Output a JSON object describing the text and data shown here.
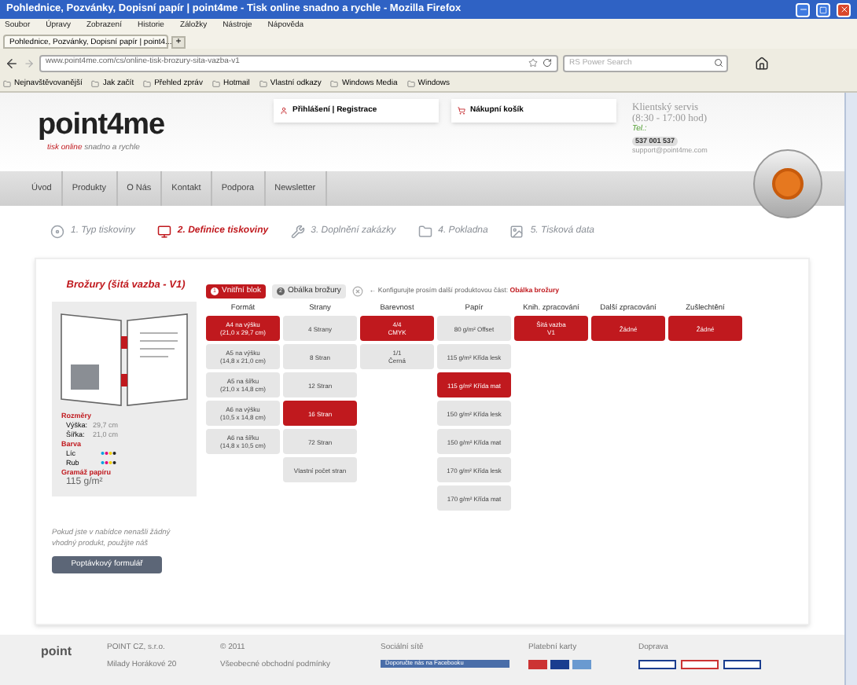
{
  "browser": {
    "title": "Pohlednice, Pozvánky, Dopisní papír | point4me - Tisk online snadno a rychle - Mozilla Firefox",
    "menu": [
      "Soubor",
      "Úpravy",
      "Zobrazení",
      "Historie",
      "Záložky",
      "Nástroje",
      "Nápověda"
    ],
    "tab": "Pohlednice, Pozvánky, Dopisní papír | point4...",
    "new_tab": "+",
    "url": "www.point4me.com/cs/online-tisk-brozury-sita-vazba-v1",
    "search_placeholder": "RS Power Search",
    "bookmarks": [
      "Nejnavštěvovanější",
      "Jak začít",
      "Přehled zpráv",
      "Hotmail",
      "Vlastní odkazy",
      "Windows Media",
      "Windows"
    ]
  },
  "header": {
    "logo": "point4me",
    "tagline_accent": "tisk online",
    "tagline": "snadno a rychle",
    "login": "Přihlášení | Registrace",
    "cart": "Nákupní košík",
    "service": "Klientský servis",
    "hours": "(8:30 - 17:00 hod)",
    "tel_label": "Tel.:",
    "phone": "537 001 537",
    "email": "support@point4me.com"
  },
  "nav": [
    "Úvod",
    "Produkty",
    "O Nás",
    "Kontakt",
    "Podpora",
    "Newsletter"
  ],
  "steps": [
    {
      "label": "1. Typ tiskoviny",
      "selected": false
    },
    {
      "label": "2. Definice tiskoviny",
      "selected": true
    },
    {
      "label": "3. Doplnění zakázky",
      "selected": false
    },
    {
      "label": "4. Pokladna",
      "selected": false
    },
    {
      "label": "5. Tisková data",
      "selected": false
    }
  ],
  "product": {
    "title": "Brožury (šitá vazba - V1)",
    "size_heading": "Rozměry",
    "height_label": "Výška:",
    "height": "29,7 cm",
    "width_label": "Šířka:",
    "width": "21,0 cm",
    "color_heading": "Barva",
    "front": "Líc",
    "back": "Rub",
    "paper_heading": "Gramáž papíru",
    "paper": "115 g/m²"
  },
  "note": "Pokud jste v nabídce nenašli žádný vhodný produkt, použijte náš",
  "inquiry_button": "Poptávkový formulář",
  "config": {
    "tabs": [
      {
        "number": "1",
        "label": "Vnitřní blok",
        "selected": true
      },
      {
        "number": "2",
        "label": "Obálka brožury",
        "selected": false
      }
    ],
    "hint": "← Konfigurujte prosím další produktovou část:",
    "hint_link": "Obálka brožury",
    "columns": [
      {
        "header": "Formát",
        "options": [
          {
            "label": "A4 na výšku",
            "sub": "(21,0 x 29,7 cm)",
            "selected": true
          },
          {
            "label": "A5 na výšku",
            "sub": "(14,8 x 21,0 cm)",
            "selected": false
          },
          {
            "label": "A5 na šířku",
            "sub": "(21,0 x 14,8 cm)",
            "selected": false
          },
          {
            "label": "A6 na výšku",
            "sub": "(10,5 x 14,8 cm)",
            "selected": false
          },
          {
            "label": "A6 na šířku",
            "sub": "(14,8 x 10,5 cm)",
            "selected": false
          }
        ]
      },
      {
        "header": "Strany",
        "options": [
          {
            "label": "4 Strany",
            "selected": false
          },
          {
            "label": "8 Stran",
            "selected": false
          },
          {
            "label": "12 Stran",
            "selected": false
          },
          {
            "label": "16 Stran",
            "selected": true
          },
          {
            "label": "72 Stran",
            "selected": false
          },
          {
            "label": "Vlastní počet stran",
            "selected": false
          }
        ]
      },
      {
        "header": "Barevnost",
        "options": [
          {
            "label": "4/4",
            "sub": "CMYK",
            "selected": true
          },
          {
            "label": "1/1",
            "sub": "Černá",
            "selected": false
          }
        ]
      },
      {
        "header": "Papír",
        "options": [
          {
            "label": "80 g/m² Offset",
            "selected": false
          },
          {
            "label": "115 g/m² Křída lesk",
            "selected": false
          },
          {
            "label": "115 g/m² Křída mat",
            "selected": true
          },
          {
            "label": "150 g/m² Křída lesk",
            "selected": false
          },
          {
            "label": "150 g/m² Křída mat",
            "selected": false
          },
          {
            "label": "170 g/m² Křída lesk",
            "selected": false
          },
          {
            "label": "170 g/m² Křída mat",
            "selected": false
          }
        ]
      },
      {
        "header": "Knih. zpracování",
        "options": [
          {
            "label": "Šitá vazba",
            "sub": "V1",
            "selected": true
          }
        ]
      },
      {
        "header": "Další zpracování",
        "options": [
          {
            "label": "Žádné",
            "selected": true
          }
        ]
      },
      {
        "header": "Zušlechtění",
        "options": [
          {
            "label": "Žádné",
            "selected": true
          }
        ]
      }
    ]
  },
  "footer": {
    "logo": "point",
    "company": "POINT CZ, s.r.o.",
    "address": "Milady Horákové 20",
    "copyright": "© 2011",
    "terms": "Všeobecné obchodní podmínky",
    "social": "Sociální sítě",
    "facebook": "Doporučte nás na Facebooku",
    "cards": "Platební karty",
    "shipping": "Doprava"
  }
}
